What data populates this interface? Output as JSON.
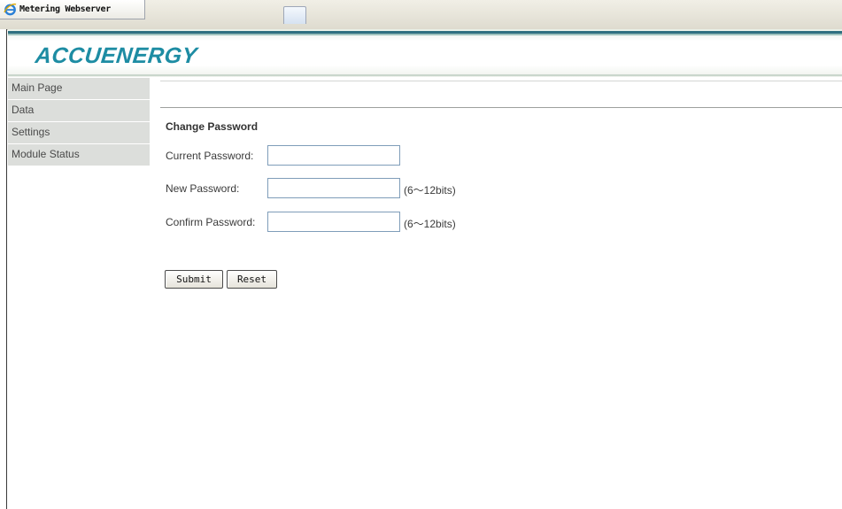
{
  "browser": {
    "tab_title": "Metering Webserver",
    "tab_icon": "ie-browser-icon"
  },
  "header": {
    "logo_text": "ACCUENERGY",
    "accent_color": "#1d8ca3",
    "rule_color": "#2f7080"
  },
  "sidebar": {
    "items": [
      {
        "label": "Main Page"
      },
      {
        "label": "Data"
      },
      {
        "label": "Settings"
      },
      {
        "label": "Module Status"
      }
    ]
  },
  "form": {
    "title": "Change Password",
    "current_password": {
      "label": "Current Password:",
      "value": ""
    },
    "new_password": {
      "label": "New Password:",
      "value": "",
      "hint": "(6～12bits)"
    },
    "confirm_password": {
      "label": "Confirm Password:",
      "value": "",
      "hint": "(6～12bits)"
    },
    "submit_label": "Submit",
    "reset_label": "Reset"
  }
}
